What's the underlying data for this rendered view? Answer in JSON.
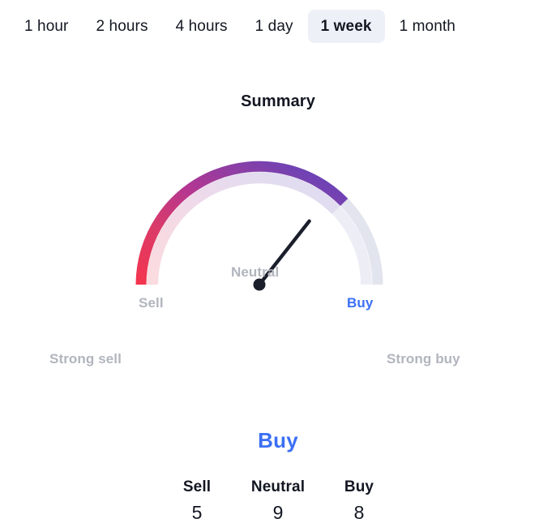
{
  "timeframes": {
    "selected": "1 week",
    "tabs": [
      {
        "label": "1 hour"
      },
      {
        "label": "2 hours"
      },
      {
        "label": "4 hours"
      },
      {
        "label": "1 day"
      },
      {
        "label": "1 week"
      },
      {
        "label": "1 month"
      }
    ]
  },
  "summary": {
    "title": "Summary",
    "verdict": "Buy",
    "verdict_color": "#3b6ff5"
  },
  "gauge": {
    "labels": {
      "strong_sell": "Strong sell",
      "sell": "Sell",
      "neutral": "Neutral",
      "buy": "Buy",
      "strong_buy": "Strong buy"
    },
    "needle_angle_deg": 52,
    "filled_end_deg": 142,
    "colors": {
      "start": "#f4354e",
      "mid": "#b43691",
      "end": "#5a44c0",
      "track": "#dfe1ec",
      "label": "#b2b5be",
      "accent": "#3b6ff5",
      "needle": "#1b1f2b"
    }
  },
  "counts": {
    "columns": [
      {
        "name": "Sell",
        "value": "5"
      },
      {
        "name": "Neutral",
        "value": "9"
      },
      {
        "name": "Buy",
        "value": "8"
      }
    ]
  },
  "chart_data": {
    "type": "gauge",
    "title": "Summary",
    "verdict": "Buy",
    "categories": [
      "Strong sell",
      "Sell",
      "Neutral",
      "Buy",
      "Strong buy"
    ],
    "counts": {
      "Sell": 5,
      "Neutral": 9,
      "Buy": 8
    },
    "values": [
      5,
      9,
      8
    ],
    "value_labels": [
      "Sell",
      "Neutral",
      "Buy"
    ],
    "needle_angle_deg": 52,
    "filled_fraction": 0.79,
    "timeframe": "1 week",
    "legend_position": "around-arc",
    "grid": false
  }
}
